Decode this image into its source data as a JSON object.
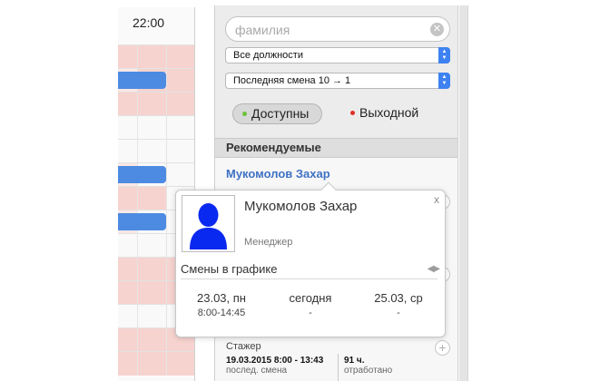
{
  "schedule": {
    "time_label": "22:00",
    "rows": [
      {
        "cells": [
          "pink",
          "pink",
          "pink"
        ],
        "bar": null
      },
      {
        "cells": [
          "blue",
          "pink",
          "pink"
        ],
        "bar": "blue"
      },
      {
        "cells": [
          "pink",
          "pink",
          "pink"
        ],
        "bar": null
      },
      {
        "cells": [
          "white",
          "white",
          "white"
        ],
        "bar": null
      },
      {
        "cells": [
          "white",
          "white",
          "white"
        ],
        "bar": null
      },
      {
        "cells": [
          "blue",
          "white",
          "white"
        ],
        "bar": "blue"
      },
      {
        "cells": [
          "pink",
          "pink",
          "white"
        ],
        "bar": null
      },
      {
        "cells": [
          "blue",
          "white",
          "white"
        ],
        "bar": "blue"
      },
      {
        "cells": [
          "white",
          "white",
          "white"
        ],
        "bar": null
      },
      {
        "cells": [
          "pink",
          "pink",
          "pink"
        ],
        "bar": null
      },
      {
        "cells": [
          "pink",
          "pink",
          "pink"
        ],
        "bar": null
      },
      {
        "cells": [
          "white",
          "white",
          "white"
        ],
        "bar": null
      },
      {
        "cells": [
          "pink",
          "pink",
          "pink"
        ],
        "bar": null
      },
      {
        "cells": [
          "pink",
          "pink",
          "pink"
        ],
        "bar": null
      }
    ]
  },
  "colors": {
    "pink": "#f6d3cf",
    "pink_light": "#fbe7e5",
    "white": "#f9f9f9",
    "bar_blue": "#4d8be2",
    "accent_blue": "#3d82f0",
    "link_blue": "#3f72c4",
    "dot_green": "#6cc13a",
    "dot_red": "#e0302c"
  },
  "panel": {
    "search": {
      "placeholder": "фамилия",
      "value": ""
    },
    "position_select": {
      "value": "Все должности"
    },
    "sort_select": {
      "value": "Последняя смена 10 → 1"
    },
    "filters": {
      "available": {
        "label": "Доступны"
      },
      "dayoff": {
        "label": "Выходной"
      }
    },
    "section_title": "Рекомендуемые",
    "employees": [
      {
        "name": "Мукомолов Захар",
        "role": "Стажер",
        "last_shift": "19.03.2015 8:00 - 13:43",
        "last_shift_label": "послед. смена",
        "hours": "91 ч.",
        "hours_label": "отработано"
      }
    ]
  },
  "popover": {
    "name": "Мукомолов Захар",
    "role": "Менеджер",
    "shifts_title": "Смены в графике",
    "close_label": "x",
    "nav_arrows": "◀▶",
    "days": [
      {
        "date": "23.03, пн",
        "time": "8:00-14:45"
      },
      {
        "date": "сегодня",
        "time": "-"
      },
      {
        "date": "25.03, ср",
        "time": "-"
      }
    ]
  }
}
